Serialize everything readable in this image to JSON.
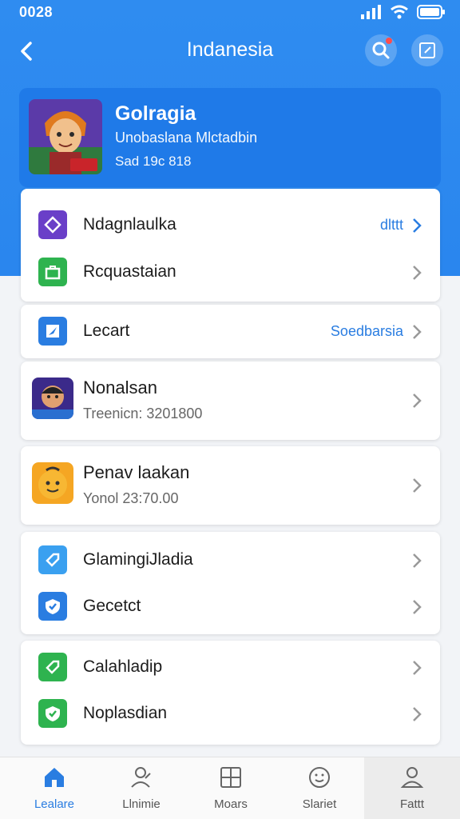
{
  "status_bar": {
    "time": "0028"
  },
  "header": {
    "title": "Indanesia"
  },
  "profile": {
    "name": "Golragia",
    "subtitle": "Unobaslana Mlctadbin",
    "meta": "Sad 19c 818"
  },
  "groups": [
    {
      "items": [
        {
          "label": "Ndagnlaulka",
          "value": "dlttt",
          "icon": "diamond-icon",
          "color": "#6a3fc8"
        },
        {
          "label": "Rcquastaian",
          "value": "",
          "icon": "briefcase-icon",
          "color": "#2eb34f"
        }
      ]
    },
    {
      "items": [
        {
          "label": "Lecart",
          "value": "Soedbarsia",
          "icon": "compass-icon",
          "color": "#2a7de1"
        }
      ]
    },
    {
      "items": [
        {
          "label": "Nonalsan",
          "subtitle": "Treenicn: 3201800",
          "icon": "game-avatar-icon"
        }
      ]
    },
    {
      "items": [
        {
          "label": "Penav laakan",
          "subtitle": "Yonol 23:70.00",
          "icon": "smiley-avatar-icon"
        }
      ]
    },
    {
      "items": [
        {
          "label": "GlamingiJladia",
          "value": "",
          "icon": "tag-icon",
          "color": "#3aa0f0"
        },
        {
          "label": "Gecetct",
          "value": "",
          "icon": "shield-check-icon",
          "color": "#2a7de1"
        }
      ]
    },
    {
      "items": [
        {
          "label": "Calahladip",
          "value": "",
          "icon": "ticket-icon",
          "color": "#2eb34f"
        },
        {
          "label": "Noplasdian",
          "value": "",
          "icon": "shield-check-icon",
          "color": "#2eb34f"
        }
      ]
    }
  ],
  "tabs": [
    {
      "label": "Lealare",
      "icon": "home-icon"
    },
    {
      "label": "Llnimie",
      "icon": "user-edit-icon"
    },
    {
      "label": "Moars",
      "icon": "grid-icon"
    },
    {
      "label": "Slariet",
      "icon": "smile-icon"
    },
    {
      "label": "Fattt",
      "icon": "person-icon"
    }
  ],
  "colors": {
    "primary": "#2f8cf0",
    "accent": "#2a7de1"
  }
}
